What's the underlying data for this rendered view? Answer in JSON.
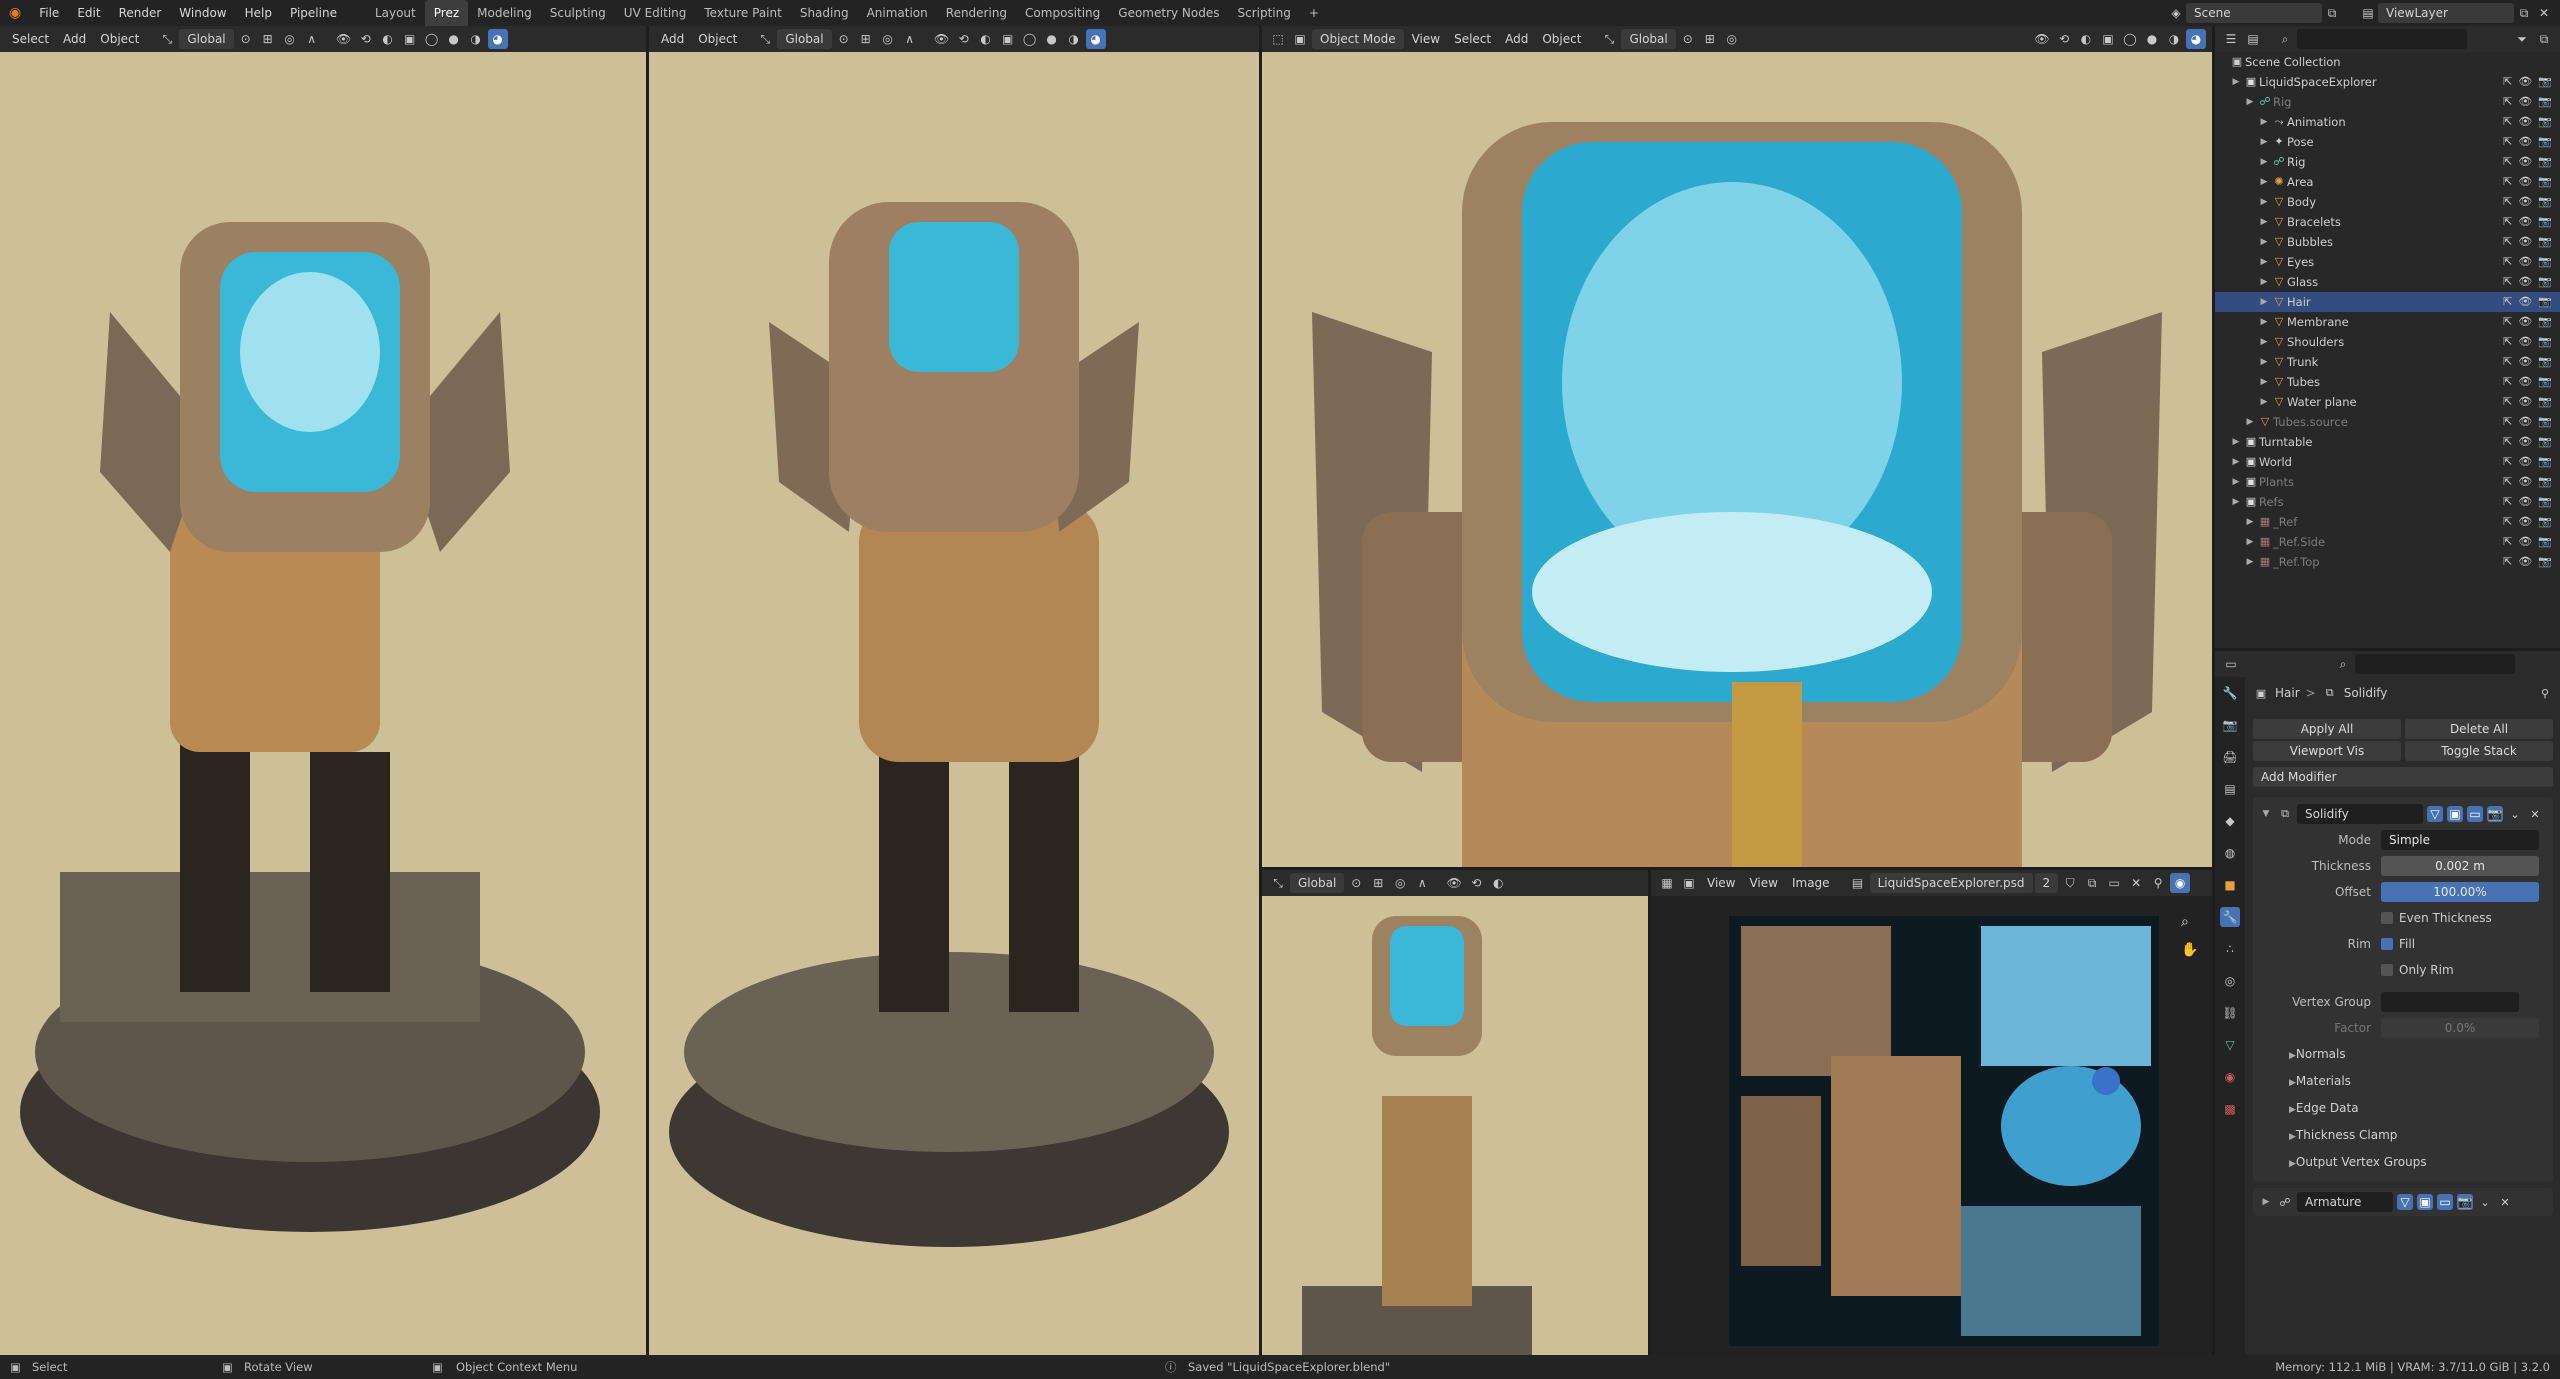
{
  "topbar": {
    "menus": [
      "File",
      "Edit",
      "Render",
      "Window",
      "Help",
      "Pipeline"
    ],
    "workspaces": [
      "Layout",
      "Prez",
      "Modeling",
      "Sculpting",
      "UV Editing",
      "Texture Paint",
      "Shading",
      "Animation",
      "Rendering",
      "Compositing",
      "Geometry Nodes",
      "Scripting"
    ],
    "active_workspace": "Prez",
    "add_tab": "+",
    "scene_label": "Scene",
    "viewlayer_label": "ViewLayer"
  },
  "viewports": {
    "left_menus": [
      "Select",
      "Add",
      "Object"
    ],
    "mid_menus": [
      "Add",
      "Object"
    ],
    "right_mode": "Object Mode",
    "right_menus": [
      "View",
      "Select",
      "Add",
      "Object"
    ],
    "orientation": "Global"
  },
  "image_editor": {
    "menus": [
      "View",
      "View",
      "Image"
    ],
    "image_name": "LiquidSpaceExplorer.psd",
    "users": "2"
  },
  "outliner": {
    "root": "Scene Collection",
    "rows": [
      {
        "label": "LiquidSpaceExplorer",
        "indent": 1,
        "icon": "collection",
        "state": "normal"
      },
      {
        "label": "Rig",
        "indent": 2,
        "icon": "armature",
        "state": "dim"
      },
      {
        "label": "Animation",
        "indent": 3,
        "icon": "action",
        "state": "normal"
      },
      {
        "label": "Pose",
        "indent": 3,
        "icon": "pose",
        "state": "normal"
      },
      {
        "label": "Rig",
        "indent": 3,
        "icon": "armature",
        "state": "normal"
      },
      {
        "label": "Area",
        "indent": 3,
        "icon": "light",
        "state": "normal"
      },
      {
        "label": "Body",
        "indent": 3,
        "icon": "mesh",
        "state": "normal"
      },
      {
        "label": "Bracelets",
        "indent": 3,
        "icon": "mesh",
        "state": "normal"
      },
      {
        "label": "Bubbles",
        "indent": 3,
        "icon": "mesh",
        "state": "normal"
      },
      {
        "label": "Eyes",
        "indent": 3,
        "icon": "mesh",
        "state": "normal"
      },
      {
        "label": "Glass",
        "indent": 3,
        "icon": "mesh",
        "state": "normal"
      },
      {
        "label": "Hair",
        "indent": 3,
        "icon": "mesh",
        "state": "selected"
      },
      {
        "label": "Membrane",
        "indent": 3,
        "icon": "mesh",
        "state": "normal"
      },
      {
        "label": "Shoulders",
        "indent": 3,
        "icon": "mesh",
        "state": "normal"
      },
      {
        "label": "Trunk",
        "indent": 3,
        "icon": "mesh",
        "state": "normal"
      },
      {
        "label": "Tubes",
        "indent": 3,
        "icon": "mesh",
        "state": "normal"
      },
      {
        "label": "Water plane",
        "indent": 3,
        "icon": "mesh",
        "state": "normal"
      },
      {
        "label": "Tubes.source",
        "indent": 2,
        "icon": "mesh",
        "state": "dim"
      },
      {
        "label": "Turntable",
        "indent": 1,
        "icon": "collection",
        "state": "normal"
      },
      {
        "label": "World",
        "indent": 1,
        "icon": "collection",
        "state": "normal"
      },
      {
        "label": "Plants",
        "indent": 1,
        "icon": "collection",
        "state": "dim"
      },
      {
        "label": "Refs",
        "indent": 1,
        "icon": "collection",
        "state": "dim"
      },
      {
        "label": "_Ref",
        "indent": 2,
        "icon": "image",
        "state": "dim"
      },
      {
        "label": "_Ref.Side",
        "indent": 2,
        "icon": "image",
        "state": "dim"
      },
      {
        "label": "_Ref.Top",
        "indent": 2,
        "icon": "image",
        "state": "dim"
      }
    ]
  },
  "properties": {
    "breadcrumb_object": "Hair",
    "breadcrumb_separator": ">",
    "breadcrumb_modifier": "Solidify",
    "apply_all": "Apply All",
    "delete_all": "Delete All",
    "viewport_vis": "Viewport Vis",
    "toggle_stack": "Toggle Stack",
    "add_modifier": "Add Modifier",
    "modifier_name": "Solidify",
    "mode_label": "Mode",
    "mode_value": "Simple",
    "thickness_label": "Thickness",
    "thickness_value": "0.002 m",
    "offset_label": "Offset",
    "offset_value": "100.00%",
    "offset_fraction": 1.0,
    "even_thickness": "Even Thickness",
    "rim_label": "Rim",
    "fill": "Fill",
    "only_rim": "Only Rim",
    "vertex_group_label": "Vertex Group",
    "factor_label": "Factor",
    "factor_value": "0.0%",
    "subpanels": [
      "Normals",
      "Materials",
      "Edge Data",
      "Thickness Clamp",
      "Output Vertex Groups"
    ],
    "modifier2_name": "Armature"
  },
  "status": {
    "select": "Select",
    "rotate": "Rotate View",
    "context": "Object Context Menu",
    "saved": "Saved \"LiquidSpaceExplorer.blend\"",
    "memory": "Memory: 112.1 MiB | VRAM: 3.7/11.0 GiB | 3.2.0"
  }
}
